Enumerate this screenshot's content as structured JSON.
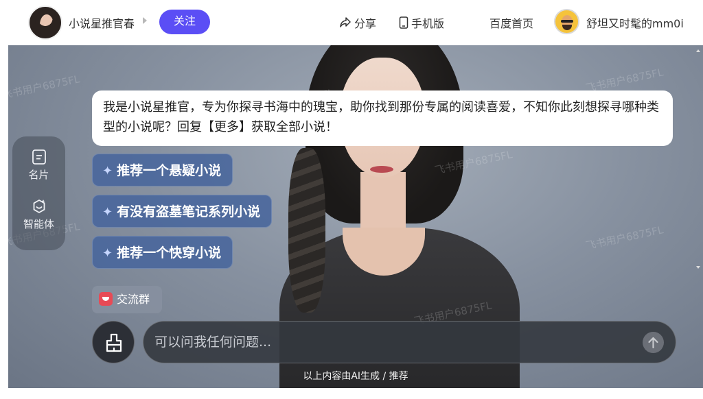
{
  "header": {
    "brand_name": "小说星推官春",
    "follow_label": "关注",
    "share_label": "分享",
    "mobile_label": "手机版",
    "home_label": "百度首页",
    "user_name": "舒坦又时髦的mm0i"
  },
  "side_rail": {
    "card_label": "名片",
    "agent_label": "智能体"
  },
  "chat": {
    "greeting": "我是小说星推官，专为你探寻书海中的瑰宝，助你找到那份专属的阅读喜爱，不知你此刻想探寻哪种类型的小说呢？回复【更多】获取全部小说！",
    "suggestions": [
      "推荐一个悬疑小说",
      "有没有盗墓笔记系列小说",
      "推荐一个快穿小说"
    ],
    "group_chip_label": "交流群",
    "input_placeholder": "可以问我任何问题...",
    "disclaimer": "以上内容由AI生成 / 推荐"
  },
  "watermark_text": "飞书用户6875FL",
  "colors": {
    "accent": "#5b4ef5",
    "suggestion_bg": "#48659c",
    "group_icon": "#e84a55"
  },
  "icons": [
    "share-icon",
    "phone-icon",
    "card-icon",
    "agent-icon",
    "sparkle-icon",
    "brush-icon",
    "arrow-up-icon"
  ]
}
